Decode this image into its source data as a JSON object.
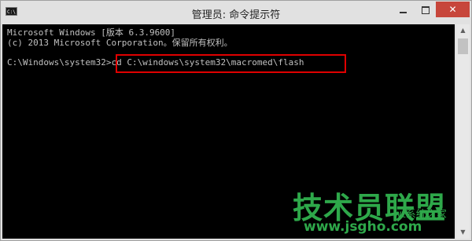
{
  "window": {
    "title": "管理员: 命令提示符",
    "icon_label": "C:\\",
    "buttons": {
      "minimize": "minimize-icon",
      "maximize": "maximize-icon",
      "close": "✕"
    }
  },
  "console": {
    "lines": [
      "Microsoft Windows [版本 6.3.9600]",
      "(c) 2013 Microsoft Corporation。保留所有权利。",
      "",
      "C:\\Windows\\system32>cd C:\\windows\\system32\\macromed\\flash"
    ],
    "text_color": "#c0c0c0",
    "background": "#000000"
  },
  "highlight": {
    "color": "#e00000"
  },
  "scrollbar": {
    "up_icon": "▲",
    "down_icon": "▼"
  },
  "watermark": {
    "logo_text": "技术员联盟",
    "sub_text": "wt系统之家",
    "url": "www.jsgho.com",
    "color": "#2ea84a"
  }
}
